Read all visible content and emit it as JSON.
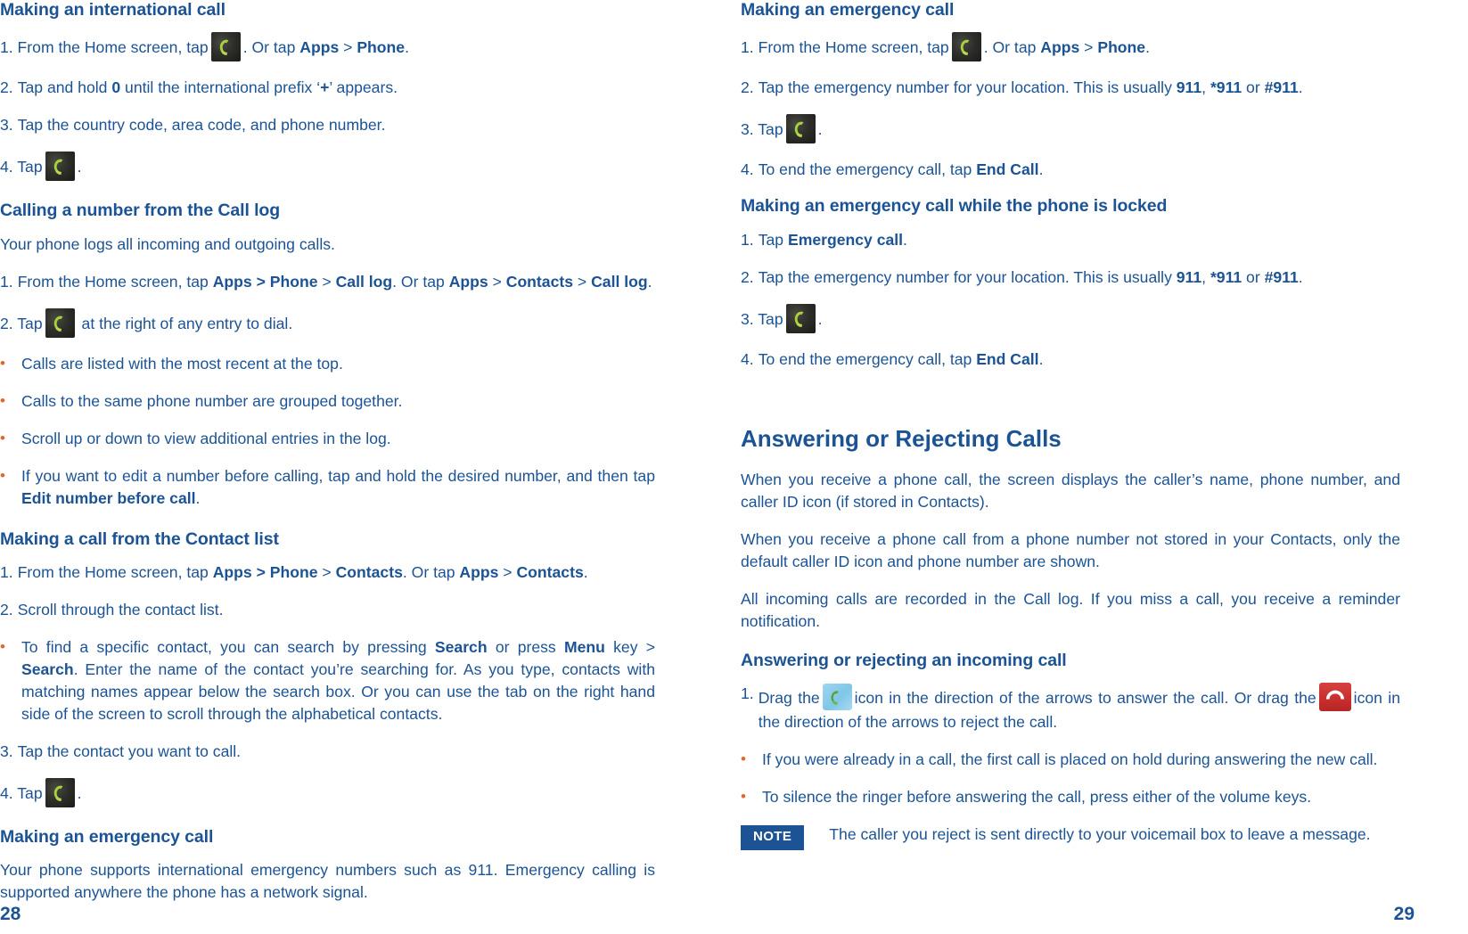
{
  "document": {
    "type": "phone-user-manual-spread",
    "text_color": "#1b5394",
    "bullet_color": "#e2682a",
    "note_badge_bg": "#1b5394"
  },
  "left_page": {
    "folio": "28",
    "sections": [
      {
        "heading": "Making an international call",
        "items": [
          {
            "num": "1.",
            "pre": "From the Home screen, tap",
            "icon": "phone-icon",
            "post_plain_1": ". Or tap ",
            "post_bold_1": "Apps",
            "post_plain_2": " > ",
            "post_bold_2": "Phone",
            "post_plain_3": "."
          },
          {
            "num": "2.",
            "text": "Tap and hold 0 until the international prefix ‘+’ appears.",
            "bold_parts": [
              "0",
              "+"
            ]
          },
          {
            "num": "3.",
            "text": "Tap the country code, area code, and phone number."
          },
          {
            "num": "4.",
            "pre": "Tap",
            "icon": "phone-icon",
            "post_plain_1": "."
          }
        ]
      },
      {
        "heading": "Calling a number from the Call log",
        "intro": "Your phone logs all incoming and outgoing calls.",
        "items": [
          {
            "num": "1.",
            "text": "From the Home screen, tap Apps > Phone > Call log. Or tap Apps > Contacts > Call log."
          },
          {
            "num": "2.",
            "pre": "Tap",
            "icon": "phone-icon",
            "post_plain_1": "at the right of any entry to dial."
          }
        ],
        "bullets": [
          "Calls are listed with the most recent at the top.",
          "Calls to the same phone number are grouped together.",
          "Scroll up or down to view additional entries in the log.",
          "If you want to edit a number before calling, tap and hold the desired number, and then tap Edit number before call."
        ]
      },
      {
        "heading": "Making a call from the Contact list",
        "items": [
          {
            "num": "1.",
            "text": "From the Home screen, tap Apps > Phone > Contacts. Or tap Apps > Contacts."
          },
          {
            "num": "2.",
            "text": "Scroll through the contact list."
          }
        ],
        "bullets": [
          "To find a specific contact, you can search by pressing Search or press Menu key > Search. Enter the name of the contact you’re searching for. As you type, contacts with matching names appear below the search box. Or you can use the tab on the right hand side of the screen to scroll through the alphabetical contacts."
        ],
        "items2": [
          {
            "num": "3.",
            "text": "Tap the contact you want to call."
          },
          {
            "num": "4.",
            "pre": "Tap",
            "icon": "phone-icon",
            "post_plain_1": "."
          }
        ]
      },
      {
        "heading": "Making an emergency call",
        "paragraph": "Your phone supports international emergency numbers such as 911. Emergency calling is supported anywhere the phone has a network signal."
      }
    ],
    "labels": {
      "h1_making_international_call": "Making an international call",
      "step1_pre": "1. From the Home screen, tap",
      "step1_mid": ". Or tap ",
      "apps": "Apps",
      "gt": " > ",
      "phone": "Phone",
      "period": ".",
      "step2_num": "2.",
      "step2_a": "Tap and hold ",
      "step2_zero": "0",
      "step2_b": " until the international prefix ‘",
      "step2_plus": "+",
      "step2_c": "’ appears.",
      "step3_num": "3.",
      "step3_text": "Tap the country code, area code, and phone number.",
      "step4_num": "4.",
      "step4_tap": "Tap",
      "h2_calling_from_call_log": "Calling a number from the Call log",
      "call_log_intro": "Your phone logs all incoming and outgoing calls.",
      "cl_step1_num": "1.",
      "cl_step1_a": "From the Home screen, tap ",
      "cl_apps_phone": "Apps > Phone",
      "cl_step1_b": " > ",
      "cl_call_log": "Call log",
      "cl_step1_c": ". Or tap ",
      "cl_apps": "Apps",
      "cl_step1_d": " > ",
      "cl_contacts": "Contacts",
      "cl_step1_e": " > ",
      "cl_call_log2": "Call log",
      "cl_step1_f": ".",
      "cl_step2_num": "2.",
      "cl_step2_tap": "Tap",
      "cl_step2_rest": "at the right of any entry to dial.",
      "b1": "Calls are listed with the most recent at the top.",
      "b2": "Calls to the same phone number are grouped together.",
      "b3": "Scroll up or down to view additional entries in the log.",
      "b4_a": "If you want to edit a number before calling, tap and hold the desired number, and then tap ",
      "b4_bold": "Edit number before call",
      "b4_c": ".",
      "h3_call_from_contact_list": "Making a call from the Contact list",
      "ct_step1_num": "1.",
      "ct_step1_a": "From the Home screen, tap ",
      "ct_apps_phone": "Apps > Phone",
      "ct_step1_b": " > ",
      "ct_contacts": "Contacts",
      "ct_step1_c": ". Or tap ",
      "ct_apps": "Apps",
      "ct_step1_d": " > ",
      "ct_contacts2": "Contacts",
      "ct_step1_e": ".",
      "ct_step2_num": "2.",
      "ct_step2_text": "Scroll through the contact list.",
      "ct_b1_a": "To find a specific contact, you can search by pressing ",
      "ct_b1_search": "Search",
      "ct_b1_b": " or press ",
      "ct_b1_menu": "Menu",
      "ct_b1_c": " key > ",
      "ct_b1_search2": "Search",
      "ct_b1_d": ". Enter the name of the contact you’re searching for. As you type, contacts with matching names appear below the search box. Or you can use the tab on the right hand side of the screen to scroll through the alphabetical contacts.",
      "ct_step3_num": "3.",
      "ct_step3_text": "Tap the contact you want to call.",
      "ct_step4_num": "4.",
      "ct_step4_tap": "Tap",
      "h4_emergency": "Making an emergency call",
      "emergency_para": "Your phone supports international emergency numbers such as 911. Emergency calling is supported anywhere the phone has a network signal."
    }
  },
  "right_page": {
    "folio": "29",
    "labels": {
      "h1_emergency": "Making an emergency call",
      "e_step1_num": "1.",
      "e_step1_a": "From the Home screen, tap",
      "e_step1_b": ". Or tap ",
      "e_apps": "Apps",
      "e_gt": " > ",
      "e_phone": "Phone",
      "e_dot": ".",
      "e_step2_num": "2.",
      "e_step2_a": "Tap the emergency number for your location. This is usually ",
      "e_911": "911",
      "e_step2_b": ", ",
      "e_s911": "*911",
      "e_step2_c": " or ",
      "e_h911": "#911",
      "e_step2_d": ".",
      "e_step3_num": "3.",
      "e_step3_tap": "Tap",
      "e_step3_dot": ".",
      "e_step4_num": "4.",
      "e_step4_a": "To end the emergency call, tap ",
      "e_end_call": "End Call",
      "e_step4_b": ".",
      "h2_emergency_locked": "Making an emergency call while the phone is locked",
      "l_step1_num": "1.",
      "l_step1_a": "Tap ",
      "l_emergency_call": "Emergency call",
      "l_step1_b": ".",
      "l_step2_num": "2.",
      "l_step2_a": "Tap the emergency number for your location. This is usually ",
      "l_911": "911",
      "l_step2_b": ", ",
      "l_s911": "*911",
      "l_step2_c": " or ",
      "l_h911": "#911",
      "l_step2_d": ".",
      "l_step3_num": "3.",
      "l_step3_tap": "Tap",
      "l_step3_dot": ".",
      "l_step4_num": "4.",
      "l_step4_a": "To end the emergency call, tap ",
      "l_end_call": "End Call",
      "l_step4_b": ".",
      "h3_answering_rejecting": "Answering or Rejecting Calls",
      "ar_p1": "When you receive a phone call, the screen displays the caller’s name, phone number, and caller ID icon (if stored in Contacts).",
      "ar_p2": "When you receive a phone call from a phone number not stored in your Contacts, only the default caller ID icon and phone number are shown.",
      "ar_p3": "All incoming calls are recorded in the Call log. If you miss a call, you receive a reminder notification.",
      "h4_answering_incoming": "Answering or rejecting an incoming call",
      "ai_step1_num": "1.",
      "ai_step1_a": "Drag the",
      "ai_step1_b": "icon in the direction of the arrows to answer the call. Or drag the",
      "ai_step1_c": "icon in the direction of the arrows to reject the call.",
      "ai_b1": "If you were already in a call, the first call is placed on hold during answering the new call.",
      "ai_b2": "To silence the ringer before answering the call, press either of the volume keys.",
      "note_badge": "NOTE",
      "note_text": "The caller you reject is sent directly to your voicemail box to leave a message."
    }
  }
}
